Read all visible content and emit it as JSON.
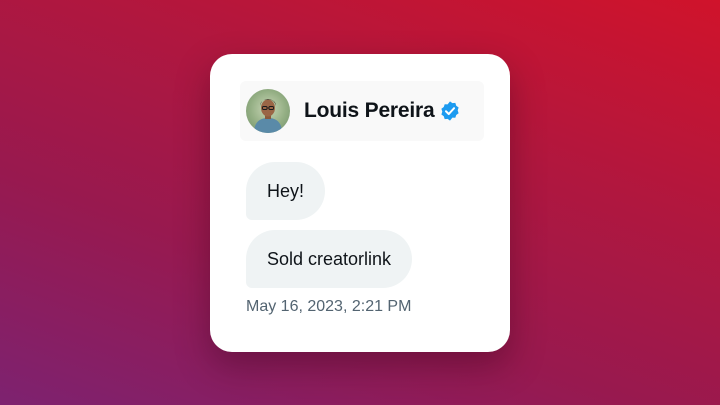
{
  "conversation": {
    "user_name": "Louis Pereira",
    "verified": true,
    "avatar_icon": "user-avatar",
    "verified_icon": "verified-badge-icon",
    "messages": [
      {
        "text": "Hey!"
      },
      {
        "text": "Sold creatorlink"
      }
    ],
    "timestamp": "May 16, 2023, 2:21 PM"
  },
  "colors": {
    "background_top_right": "#d0132b",
    "background_bottom_left": "#7d2270",
    "card": "#ffffff",
    "bubble": "#eff3f4",
    "text": "#0f1419",
    "timestamp": "#536471",
    "verified_badge": "#1d9bf0"
  }
}
